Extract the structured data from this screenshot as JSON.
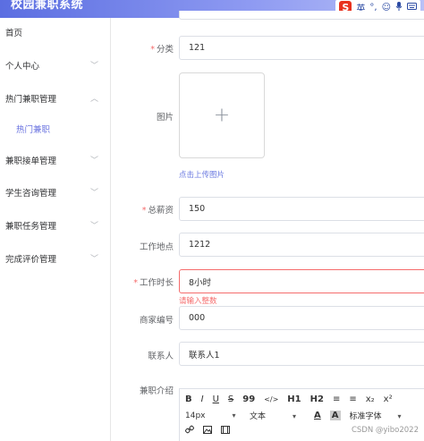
{
  "header": {
    "app_title": "校园兼职系统",
    "ime": {
      "logo": "S",
      "mode": "英",
      "icons": [
        "punctuation-icon",
        "emoji-icon",
        "microphone-icon",
        "keyboard-icon"
      ]
    }
  },
  "sidebar": {
    "items": [
      {
        "label": "首页"
      },
      {
        "label": "个人中心"
      },
      {
        "label": "热门兼职管理"
      },
      {
        "label": "热门兼职"
      },
      {
        "label": "兼职接单管理"
      },
      {
        "label": "学生咨询管理"
      },
      {
        "label": "兼职任务管理"
      },
      {
        "label": "完成评价管理"
      }
    ]
  },
  "form": {
    "category": {
      "label": "分类",
      "required": "*",
      "value": "121"
    },
    "image": {
      "label": "图片",
      "plus": "+",
      "hint": "点击上传图片"
    },
    "total_salary": {
      "label": "总薪资",
      "required": "*",
      "value": "150"
    },
    "location": {
      "label": "工作地点",
      "value": "1212"
    },
    "duration": {
      "label": "工作时长",
      "required": "*",
      "value": "8小时",
      "error": "请输入整数"
    },
    "merchant_id": {
      "label": "商家编号",
      "value": "000"
    },
    "contact": {
      "label": "联系人",
      "value": "联系人1"
    },
    "description": {
      "label": "兼职介绍"
    }
  },
  "editor": {
    "row1": [
      "B",
      "I",
      "U",
      "S",
      "99",
      "</>",
      "H1",
      "H2",
      "≡",
      "≡",
      "x₂",
      "x²"
    ],
    "font_size": "14px",
    "text_style": "文本",
    "text_color": "A",
    "bg_color": "A",
    "font_family": "标准字体"
  },
  "watermark": "CSDN @yibo2022"
}
